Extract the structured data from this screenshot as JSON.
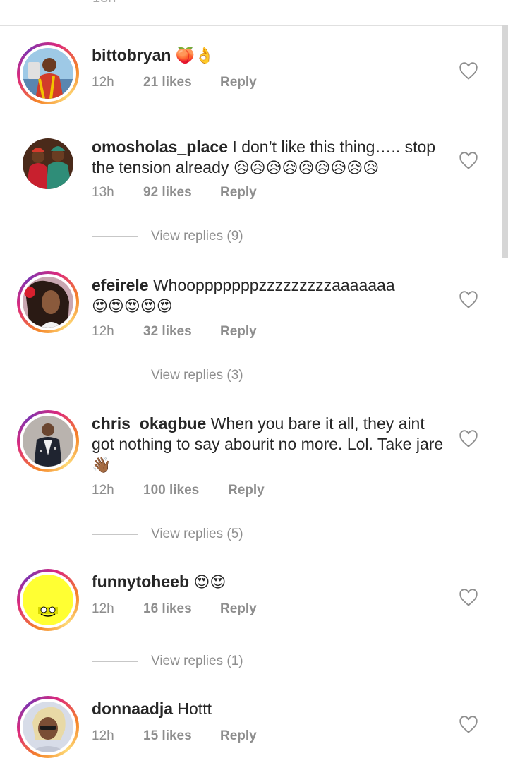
{
  "top": {
    "cut_text": "13h"
  },
  "labels": {
    "reply": "Reply"
  },
  "comments": [
    {
      "username": "bittobryan",
      "text": "",
      "emoji": "🍑👌",
      "time": "12h",
      "likes": "21 likes"
    },
    {
      "username": "omosholas_place",
      "text": "I don’t like this thing….. stop the tension already",
      "emoji": "😥😥😥😥😥😥😥😥😥",
      "time": "13h",
      "likes": "92 likes",
      "view_replies": "View replies (9)"
    },
    {
      "username": "efeirele",
      "text": "Whoopppppppzzzzzzzzzaaaaaaa",
      "emoji": "😍😍😍😍😍",
      "time": "12h",
      "likes": "32 likes",
      "view_replies": "View replies (3)"
    },
    {
      "username": "chris_okagbue",
      "text": "When you bare it all, they aint got nothing to say abourit no more. Lol. Take jare",
      "emoji": "👋🏾",
      "time": "12h",
      "likes": "100 likes",
      "view_replies": "View replies (5)"
    },
    {
      "username": "funnytoheeb",
      "text": "",
      "emoji": "😍😍",
      "time": "12h",
      "likes": "16 likes",
      "view_replies": "View replies (1)"
    },
    {
      "username": "donnaadja",
      "text": "Hottt",
      "emoji": "",
      "time": "12h",
      "likes": "15 likes"
    }
  ],
  "colors": {
    "meta_gray": "#8e8e8e",
    "text": "#262626"
  }
}
